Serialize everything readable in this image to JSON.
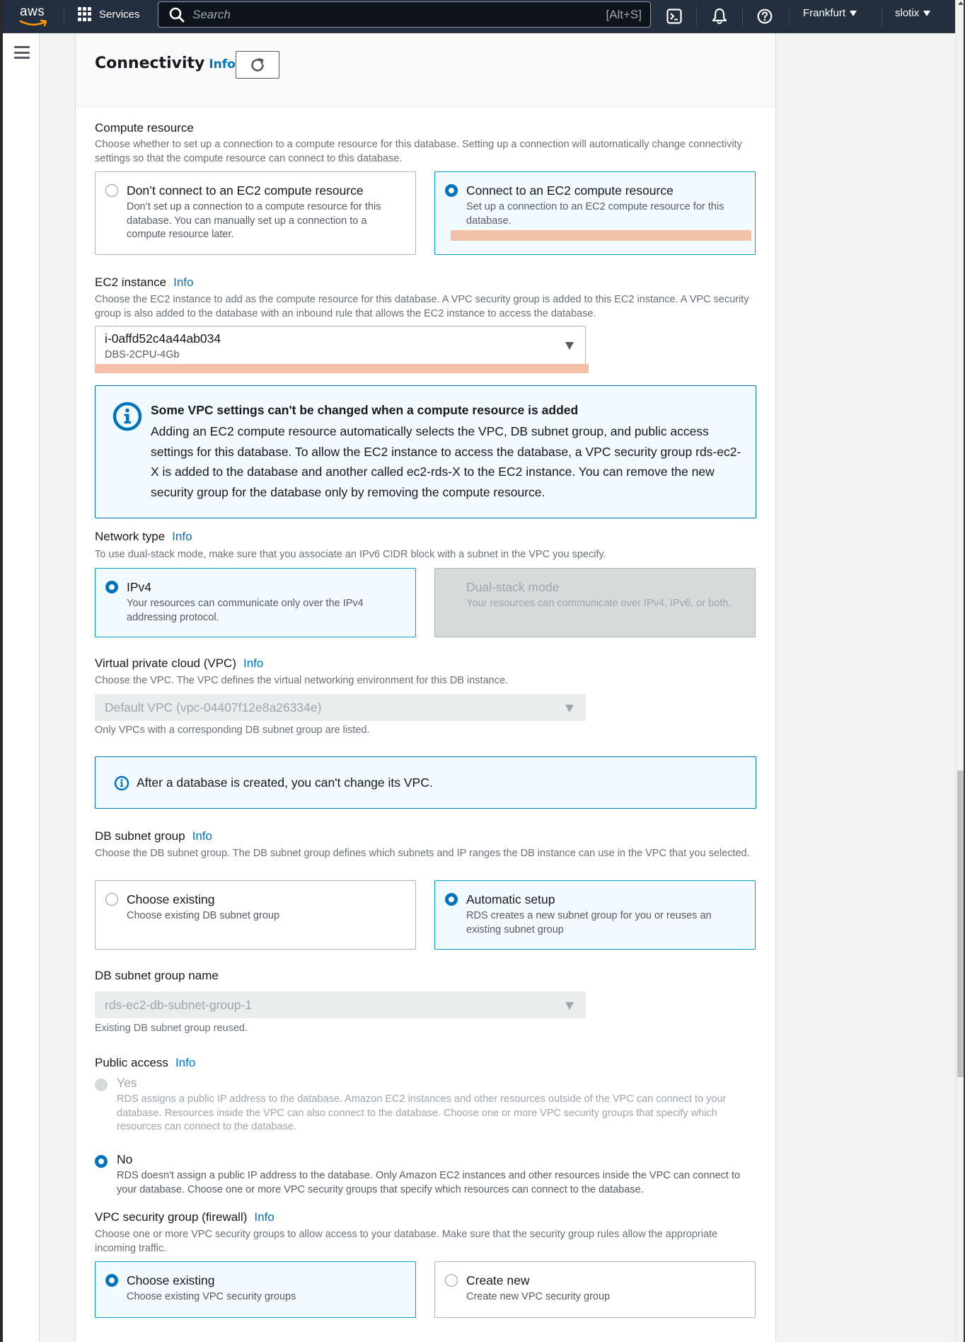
{
  "topnav": {
    "logo": "aws",
    "services_label": "Services",
    "search_placeholder": "Search",
    "search_shortcut": "[Alt+S]",
    "region": "Frankfurt",
    "account": "slotix",
    "icons": [
      "cloudshell-icon",
      "bell-icon",
      "help-icon"
    ]
  },
  "section": {
    "title": "Connectivity",
    "info": "Info"
  },
  "compute_resource": {
    "label": "Compute resource",
    "description": "Choose whether to set up a connection to a compute resource for this database. Setting up a connection will automatically change connectivity settings so that the compute resource can connect to this database.",
    "options": [
      {
        "title": "Don’t connect to an EC2 compute resource",
        "description": "Don’t set up a connection to a compute resource for this database. You can manually set up a connection to a compute resource later.",
        "selected": false
      },
      {
        "title": "Connect to an EC2 compute resource",
        "description": "Set up a connection to an EC2 compute resource for this database.",
        "selected": true
      }
    ]
  },
  "ec2_instance": {
    "label": "EC2 instance",
    "info": "Info",
    "description": "Choose the EC2 instance to add as the compute resource for this database. A VPC security group is added to this EC2 instance. A VPC security group is also added to the database with an inbound rule that allows the EC2 instance to access the database.",
    "value": "i-0affd52c4a44ab034",
    "sublabel": "DBS-2CPU-4Gb"
  },
  "vpc_alert": {
    "title": "Some VPC settings can't be changed when a compute resource is added",
    "body": "Adding an EC2 compute resource automatically selects the VPC, DB subnet group, and public access settings for this database. To allow the EC2 instance to access the database, a VPC security group rds-ec2-X is added to the database and another called ec2-rds-X to the EC2 instance. You can remove the new security group for the database only by removing the compute resource."
  },
  "network_type": {
    "label": "Network type",
    "info": "Info",
    "description": "To use dual-stack mode, make sure that you associate an IPv6 CIDR block with a subnet in the VPC you specify.",
    "options": [
      {
        "title": "IPv4",
        "description": "Your resources can communicate only over the IPv4 addressing protocol.",
        "selected": true,
        "disabled": false
      },
      {
        "title": "Dual-stack mode",
        "description": "Your resources can communicate over IPv4, IPv6, or both.",
        "selected": false,
        "disabled": true
      }
    ]
  },
  "vpc": {
    "label": "Virtual private cloud (VPC)",
    "info": "Info",
    "description": "Choose the VPC. The VPC defines the virtual networking environment for this DB instance.",
    "value": "Default VPC (vpc-04407f12e8a26334e)",
    "hint": "Only VPCs with a corresponding DB subnet group are listed.",
    "alert": "After a database is created, you can't change its VPC."
  },
  "db_subnet_group": {
    "label": "DB subnet group",
    "info": "Info",
    "description": "Choose the DB subnet group. The DB subnet group defines which subnets and IP ranges the DB instance can use in the VPC that you selected.",
    "options": [
      {
        "title": "Choose existing",
        "description": "Choose existing DB subnet group",
        "selected": false
      },
      {
        "title": "Automatic setup",
        "description": "RDS creates a new subnet group for you or reuses an existing subnet group",
        "selected": true
      }
    ]
  },
  "db_subnet_group_name": {
    "label": "DB subnet group name",
    "value": "rds-ec2-db-subnet-group-1",
    "hint": "Existing DB subnet group reused."
  },
  "public_access": {
    "label": "Public access",
    "info": "Info",
    "options": [
      {
        "title": "Yes",
        "description": "RDS assigns a public IP address to the database. Amazon EC2 instances and other resources outside of the VPC can connect to your database. Resources inside the VPC can also connect to the database. Choose one or more VPC security groups that specify which resources can connect to the database.",
        "selected": false,
        "disabled": true
      },
      {
        "title": "No",
        "description": "RDS doesn't assign a public IP address to the database. Only Amazon EC2 instances and other resources inside the VPC can connect to your database. Choose one or more VPC security groups that specify which resources can connect to the database.",
        "selected": true,
        "disabled": false
      }
    ]
  },
  "vpc_security_group": {
    "label": "VPC security group (firewall)",
    "info": "Info",
    "description": "Choose one or more VPC security groups to allow access to your database. Make sure that the security group rules allow the appropriate incoming traffic.",
    "options": [
      {
        "title": "Choose existing",
        "description": "Choose existing VPC security groups",
        "selected": true
      },
      {
        "title": "Create new",
        "description": "Create new VPC security group",
        "selected": false
      }
    ]
  },
  "colors": {
    "nav_bg": "#232f3e",
    "link": "#0073bb",
    "selected_tile_bg": "#f1faff",
    "selected_tile_border": "#00a1c9",
    "highlight": "#f3b99e"
  }
}
